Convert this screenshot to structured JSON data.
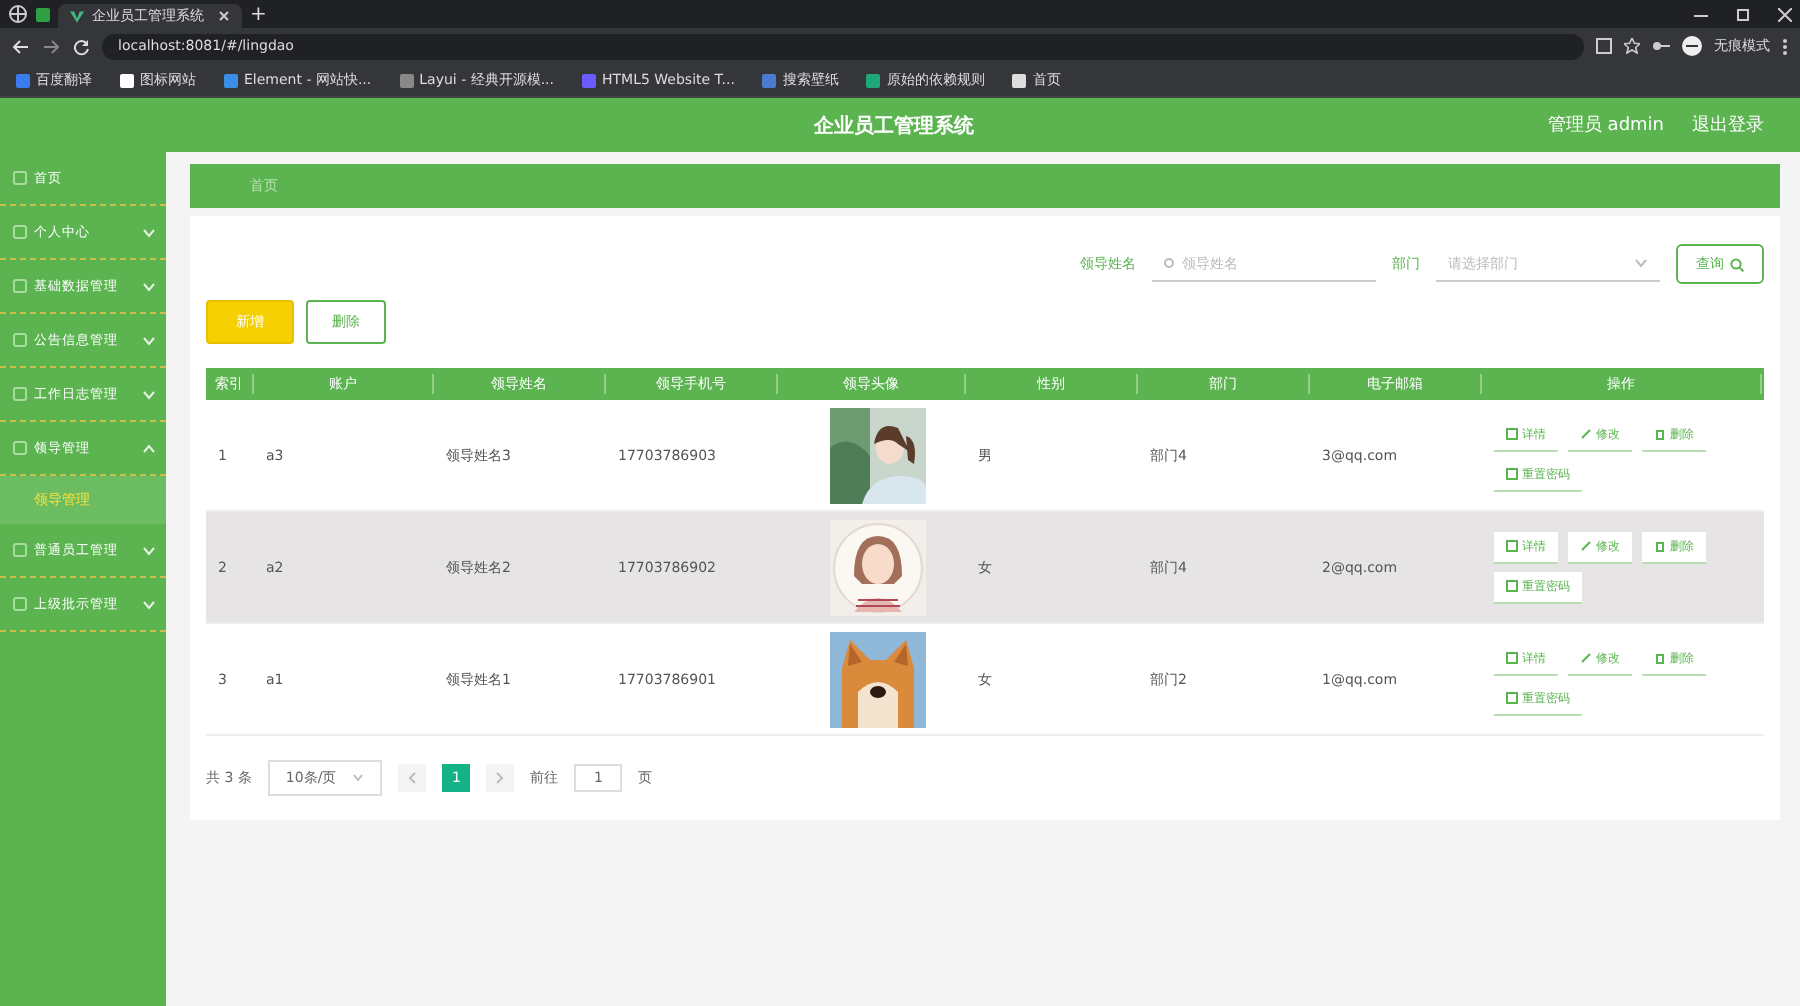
{
  "browser": {
    "tabs": [
      {
        "title": "企业员工管理系统",
        "selected": true
      }
    ],
    "new_tab": "+",
    "address": "localhost:8081/#/lingdao",
    "incognito": "无痕模式",
    "bookmarks": [
      "百度翻译",
      "图标网站",
      "Element - 网站快...",
      "Layui - 经典开源模...",
      "HTML5 Website T...",
      "搜索壁纸",
      "原始的依赖规则",
      "首页"
    ]
  },
  "header": {
    "title": "企业员工管理系统",
    "user": "管理员 admin",
    "logout": "退出登录"
  },
  "sidebar": {
    "items": [
      {
        "label": "首页"
      },
      {
        "label": "个人中心",
        "expanded": false
      },
      {
        "label": "基础数据管理",
        "expanded": false
      },
      {
        "label": "公告信息管理",
        "expanded": false
      },
      {
        "label": "工作日志管理",
        "expanded": false
      },
      {
        "label": "领导管理",
        "expanded": true,
        "children": [
          {
            "label": "领导管理",
            "selected": true
          }
        ]
      },
      {
        "label": "普通员工管理",
        "expanded": false
      },
      {
        "label": "上级批示管理",
        "expanded": false
      }
    ]
  },
  "breadcrumb": [
    "首页"
  ],
  "search": {
    "fields": [
      {
        "label": "领导姓名",
        "placeholder": "领导姓名",
        "kind": "input"
      },
      {
        "label": "部门",
        "placeholder": "请选择部门",
        "kind": "select"
      }
    ],
    "button": "查询"
  },
  "actions": [
    "新增",
    "删除"
  ],
  "table": {
    "columns": [
      "索引",
      "账户",
      "领导姓名",
      "领导手机号",
      "领导头像",
      "性别",
      "部门",
      "电子邮箱",
      "操作"
    ],
    "rows": [
      {
        "cells": [
          "1",
          "a3",
          "领导姓名3",
          "17703786903",
          "男",
          "部门4",
          "3@qq.com"
        ],
        "selected": false,
        "buttons": [
          "详情",
          "修改",
          "删除",
          "重置密码"
        ]
      },
      {
        "cells": [
          "2",
          "a2",
          "领导姓名2",
          "17703786902",
          "女",
          "部门4",
          "2@qq.com"
        ],
        "selected": true,
        "buttons": [
          "详情",
          "修改",
          "删除",
          "重置密码"
        ]
      },
      {
        "cells": [
          "3",
          "a1",
          "领导姓名1",
          "17703786901",
          "女",
          "部门2",
          "1@qq.com"
        ],
        "selected": false,
        "buttons": [
          "详情",
          "修改",
          "删除",
          "重置密码"
        ]
      }
    ]
  },
  "pagination": {
    "total": "共 3 条",
    "page_size": "10条/页",
    "pages": [
      {
        "label": "1",
        "selected": true
      }
    ],
    "goto_label": "前往",
    "goto_value": "1",
    "goto_suffix": "页"
  }
}
